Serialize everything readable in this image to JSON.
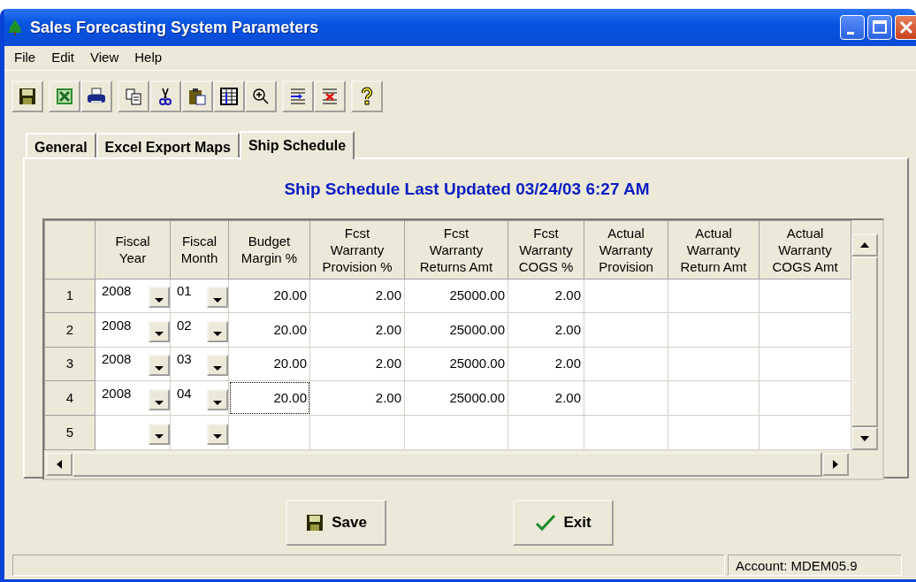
{
  "window": {
    "title": "Sales Forecasting System Parameters"
  },
  "menu": [
    "File",
    "Edit",
    "View",
    "Help"
  ],
  "tabs": [
    {
      "label": "General",
      "selected": false
    },
    {
      "label": "Excel Export Maps",
      "selected": false
    },
    {
      "label": "Ship Schedule",
      "selected": true
    }
  ],
  "heading": "Ship Schedule Last Updated 03/24/03 6:27 AM",
  "table": {
    "columns": [
      "Fiscal\nYear",
      "Fiscal\nMonth",
      "Budget\nMargin %",
      "Fcst\nWarranty\nProvision %",
      "Fcst\nWarranty\nReturns Amt",
      "Fcst\nWarranty\nCOGS %",
      "Actual\nWarranty\nProvision",
      "Actual\nWarranty\nReturn Amt",
      "Actual\nWarranty\nCOGS Amt"
    ],
    "rows": [
      {
        "number": "1",
        "fiscal_year": "2008",
        "fiscal_month": "01",
        "values": [
          "20.00",
          "2.00",
          "25000.00",
          "2.00"
        ],
        "focused": false
      },
      {
        "number": "2",
        "fiscal_year": "2008",
        "fiscal_month": "02",
        "values": [
          "20.00",
          "2.00",
          "25000.00",
          "2.00"
        ],
        "focused": false
      },
      {
        "number": "3",
        "fiscal_year": "2008",
        "fiscal_month": "03",
        "values": [
          "20.00",
          "2.00",
          "25000.00",
          "2.00"
        ],
        "focused": false
      },
      {
        "number": "4",
        "fiscal_year": "2008",
        "fiscal_month": "04",
        "values": [
          "20.00",
          "2.00",
          "25000.00",
          "2.00"
        ],
        "focused": true
      },
      {
        "number": "5",
        "focused": false
      }
    ]
  },
  "buttons": [
    {
      "label": "Save",
      "kind": "save"
    },
    {
      "label": "Exit",
      "kind": "exit"
    }
  ],
  "status_bar": {
    "account": "Account: MDEM05.9"
  }
}
